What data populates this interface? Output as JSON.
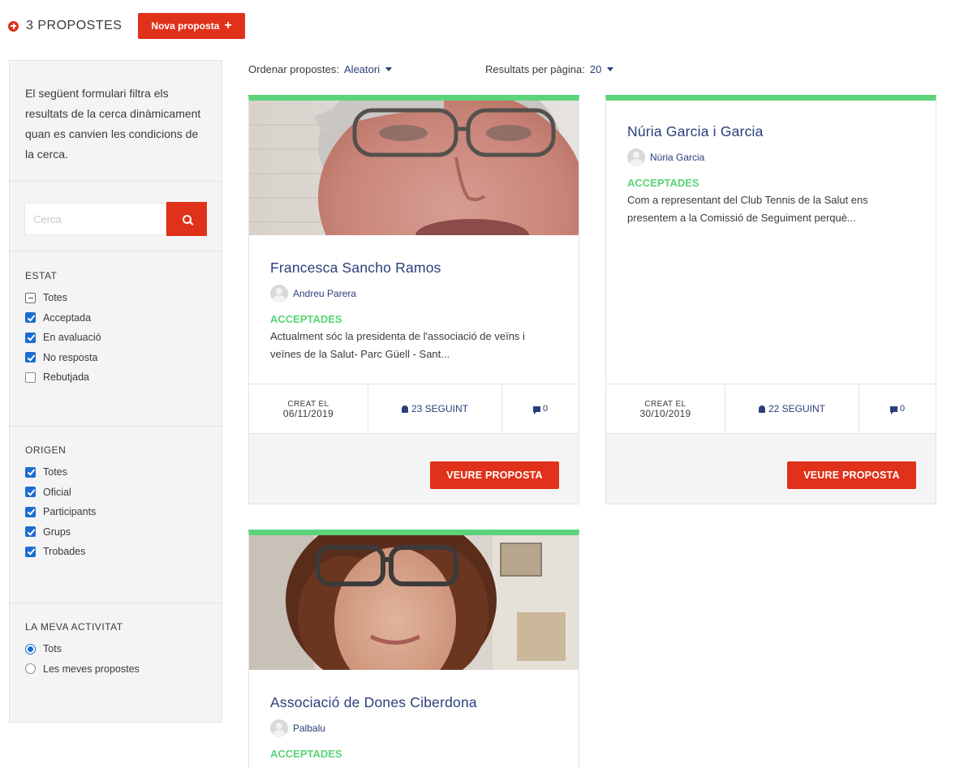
{
  "header": {
    "count_title": "3 PROPOSTES",
    "new_button_label": "Nova proposta",
    "new_button_icon": "+"
  },
  "sidebar": {
    "intro": "El següent formulari filtra els resultats de la cerca dinàmicament quan es canvien les condicions de la cerca.",
    "search_placeholder": "Cerca",
    "estat": {
      "title": "ESTAT",
      "options": [
        {
          "label": "Totes",
          "state": "indeterminate"
        },
        {
          "label": "Acceptada",
          "state": "checked"
        },
        {
          "label": "En avaluació",
          "state": "checked"
        },
        {
          "label": "No resposta",
          "state": "checked"
        },
        {
          "label": "Rebutjada",
          "state": "unchecked"
        }
      ]
    },
    "origen": {
      "title": "ORIGEN",
      "options": [
        {
          "label": "Totes",
          "state": "checked"
        },
        {
          "label": "Oficial",
          "state": "checked"
        },
        {
          "label": "Participants",
          "state": "checked"
        },
        {
          "label": "Grups",
          "state": "checked"
        },
        {
          "label": "Trobades",
          "state": "checked"
        }
      ]
    },
    "activitat": {
      "title": "LA MEVA ACTIVITAT",
      "options": [
        {
          "label": "Tots",
          "selected": true
        },
        {
          "label": "Les meves propostes",
          "selected": false
        }
      ]
    }
  },
  "toolbar": {
    "order_label": "Ordenar propostes:",
    "order_value": "Aleatori",
    "per_page_label": "Resultats per pàgina:",
    "per_page_value": "20"
  },
  "cards": [
    {
      "title": "Francesca Sancho Ramos",
      "author": "Andreu Parera",
      "status": "ACCEPTADES",
      "excerpt": "Actualment sóc la presidenta de l'associació de veïns i veïnes de la Salut- Parc Güell - Sant...",
      "created_label": "CREAT EL",
      "created_date": "06/11/2019",
      "followers": "23 SEGUINT",
      "comments": "0",
      "button_label": "VEURE PROPOSTA"
    },
    {
      "title": "Núria Garcia i Garcia",
      "author": "Núria Garcia",
      "status": "ACCEPTADES",
      "excerpt": "Com a representant del Club Tennis de la Salut ens presentem a la Comissió de Seguiment perquè...",
      "created_label": "CREAT EL",
      "created_date": "30/10/2019",
      "followers": "22 SEGUINT",
      "comments": "0",
      "button_label": "VEURE PROPOSTA"
    },
    {
      "title": "Associació de Dones Ciberdona",
      "author": "Palbalu",
      "status": "ACCEPTADES"
    }
  ],
  "colors": {
    "accent_red": "#e0311a",
    "link_blue": "#2a3e7a",
    "status_green": "#5ad379",
    "checkbox_blue": "#1d6dd0"
  }
}
